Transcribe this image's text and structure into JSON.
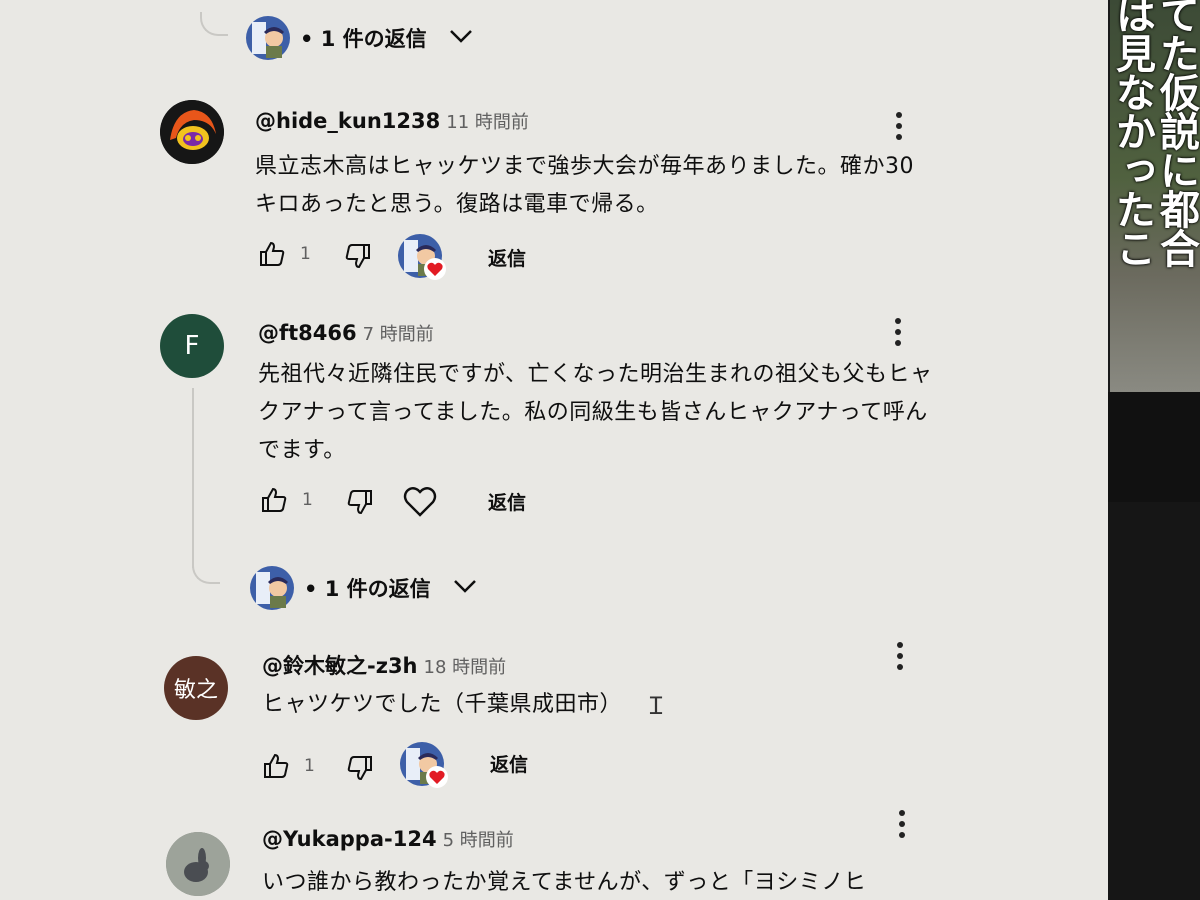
{
  "replies_toggles": [
    {
      "label": "• 1 件の返信"
    },
    {
      "label": "• 1 件の返信"
    }
  ],
  "comments": [
    {
      "author": "@hide_kun1238",
      "time": "11 時間前",
      "text": "県立志木高はヒャッケツまで強歩大会が毎年ありました。確か30キロあったと思う。復路は電車で帰る。",
      "likes": "1",
      "reply_label": "返信",
      "hearted": true
    },
    {
      "author": "@ft8466",
      "time": "7 時間前",
      "avatar_letter": "F",
      "text": "先祖代々近隣住民ですが、亡くなった明治生まれの祖父も父もヒャクアナって言ってました。私の同級生も皆さんヒャクアナって呼んでます。",
      "likes": "1",
      "reply_label": "返信",
      "hearted": false
    },
    {
      "author": "@鈴木敏之-z3h",
      "time": "18 時間前",
      "avatar_letter": "敏之",
      "text": "ヒャツケツでした（千葉県成田市）",
      "likes": "1",
      "reply_label": "返信",
      "hearted": true
    },
    {
      "author": "@Yukappa-124",
      "time": "5 時間前",
      "text": "いつ誰から教わったか覚えてませんが、ずっと「ヨシミノヒ"
    }
  ],
  "side_video": {
    "caption_lines": [
      "てた仮説に都合",
      "は見なかったこ"
    ]
  },
  "colors": {
    "page_bg": "#e9e8e4",
    "avatar_f": "#1f4d3a",
    "avatar_suzuki": "#5a3226",
    "heart": "#e21b24"
  }
}
